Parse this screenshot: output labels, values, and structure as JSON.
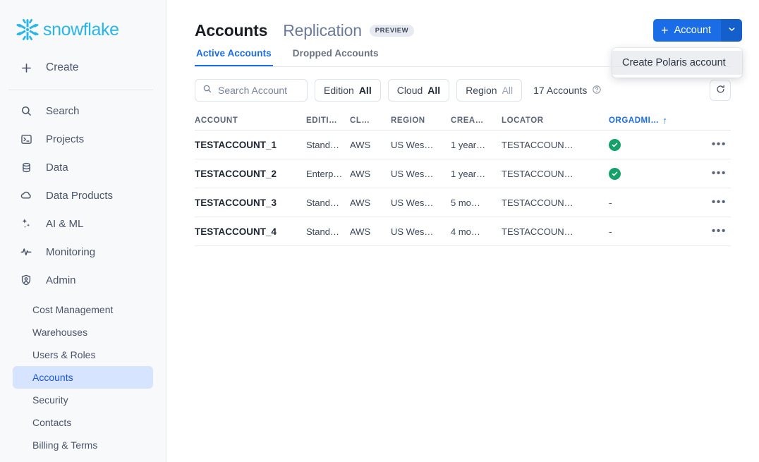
{
  "sidebar": {
    "brand": "snowflake",
    "create": {
      "label": "Create",
      "icon": "plus-icon"
    },
    "items": [
      {
        "label": "Search",
        "icon": "search-icon"
      },
      {
        "label": "Projects",
        "icon": "terminal-icon"
      },
      {
        "label": "Data",
        "icon": "database-icon"
      },
      {
        "label": "Data Products",
        "icon": "cloud-icon"
      },
      {
        "label": "AI & ML",
        "icon": "sparkles-icon"
      },
      {
        "label": "Monitoring",
        "icon": "activity-icon"
      },
      {
        "label": "Admin",
        "icon": "shield-user-icon"
      }
    ],
    "subitems": [
      {
        "label": "Cost Management",
        "active": false
      },
      {
        "label": "Warehouses",
        "active": false
      },
      {
        "label": "Users & Roles",
        "active": false
      },
      {
        "label": "Accounts",
        "active": true
      },
      {
        "label": "Security",
        "active": false
      },
      {
        "label": "Contacts",
        "active": false
      },
      {
        "label": "Billing & Terms",
        "active": false
      }
    ]
  },
  "header": {
    "title": "Accounts",
    "secondary_title": "Replication",
    "preview_badge": "PREVIEW",
    "account_button": {
      "label": "Account",
      "plus": "+",
      "caret_icon": "chevron-down-icon"
    },
    "dropdown": {
      "items": [
        "Create Polaris account"
      ]
    }
  },
  "tabs": [
    {
      "label": "Active Accounts",
      "active": true
    },
    {
      "label": "Dropped Accounts",
      "active": false
    }
  ],
  "filters": {
    "search_placeholder": "Search Account",
    "search_value": "",
    "search_icon": "search-icon",
    "chips": [
      {
        "name": "Edition",
        "value": "All",
        "muted": false
      },
      {
        "name": "Cloud",
        "value": "All",
        "muted": false
      },
      {
        "name": "Region",
        "value": "All",
        "muted": true
      }
    ],
    "count_label": "17 Accounts",
    "help_icon": "question-circle-icon",
    "refresh_icon": "refresh-icon"
  },
  "table": {
    "columns": [
      {
        "key": "account",
        "label": "ACCOUNT",
        "sorted": false
      },
      {
        "key": "edition",
        "label": "EDITI…",
        "sorted": false
      },
      {
        "key": "cloud",
        "label": "CL…",
        "sorted": false
      },
      {
        "key": "region",
        "label": "REGION",
        "sorted": false
      },
      {
        "key": "created",
        "label": "CREA…",
        "sorted": false
      },
      {
        "key": "locator",
        "label": "LOCATOR",
        "sorted": false
      },
      {
        "key": "org",
        "label": "ORGADMI…",
        "sorted": true,
        "sort_arrow": "↑"
      }
    ],
    "rows": [
      {
        "account": "TESTACCOUNT_1",
        "edition": "Stand…",
        "cloud": "AWS",
        "region": "US Wes…",
        "created": "1 year…",
        "locator": "TESTACCOUN…",
        "org_admin": true,
        "org_dash": "",
        "more_icon": "more-horizontal-icon"
      },
      {
        "account": "TESTACCOUNT_2",
        "edition": "Enterp…",
        "cloud": "AWS",
        "region": "US Wes…",
        "created": "1 year…",
        "locator": "TESTACCOUN…",
        "org_admin": true,
        "org_dash": "",
        "more_icon": "more-horizontal-icon"
      },
      {
        "account": "TESTACCOUNT_3",
        "edition": "Stand…",
        "cloud": "AWS",
        "region": "US Wes…",
        "created": "5 mo…",
        "locator": "TESTACCOUN…",
        "org_admin": false,
        "org_dash": "-",
        "more_icon": "more-horizontal-icon"
      },
      {
        "account": "TESTACCOUNT_4",
        "edition": "Stand…",
        "cloud": "AWS",
        "region": "US Wes…",
        "created": "4 mo…",
        "locator": "TESTACCOUN…",
        "org_admin": false,
        "org_dash": "-",
        "more_icon": "more-horizontal-icon"
      }
    ]
  },
  "colors": {
    "brand": "#29b5e8",
    "accent": "#1a6ce7",
    "accent_dark": "#155fcc",
    "success": "#16a06a",
    "sidebar_bg": "#f8f9fb",
    "active_sub_bg": "#d6e4ff"
  }
}
